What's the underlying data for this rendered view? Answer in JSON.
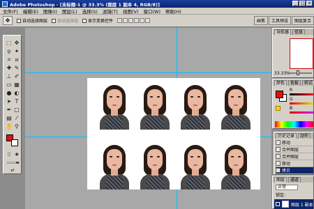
{
  "window": {
    "title": "Adobe Photoshop - [未标题-1 @ 33.3% (图层 1 副本 4, RGB/8)]"
  },
  "menu": [
    "文件(F)",
    "编辑(E)",
    "图像(I)",
    "图层(L)",
    "选择(S)",
    "滤镜(T)",
    "视图(V)",
    "窗口(W)",
    "帮助(H)"
  ],
  "options": {
    "auto_select_layer": "自动选择图层",
    "auto_select_group": "自动选择组",
    "show_transform": "显示变换控件",
    "checked": {
      "auto_select_layer": false,
      "auto_select_group": false,
      "show_transform": false
    }
  },
  "right_tabs": [
    "画笔",
    "工具预设",
    "图层复合"
  ],
  "navigator": {
    "tabs": [
      "导航器",
      "信息"
    ],
    "zoom": "33.33%"
  },
  "color_panel": {
    "tabs": [
      "颜色",
      "色板",
      "样式"
    ],
    "fg_color": "#e01010",
    "channels": [
      "R",
      "G",
      "B"
    ]
  },
  "history": {
    "tabs": [
      "历史记录",
      "动作"
    ],
    "items": [
      {
        "label": "移动",
        "selected": false
      },
      {
        "label": "合并图层",
        "selected": false
      },
      {
        "label": "合并图层",
        "selected": false
      },
      {
        "label": "移动",
        "selected": false
      },
      {
        "label": "拷贝",
        "selected": true
      }
    ]
  },
  "layers": {
    "tabs": [
      "图层",
      "通道"
    ],
    "blend_mode": "正常",
    "lock_label": "锁定:",
    "layer_name": "图层 1 副本"
  },
  "photos_grid": {
    "rows": 2,
    "cols": 4
  }
}
